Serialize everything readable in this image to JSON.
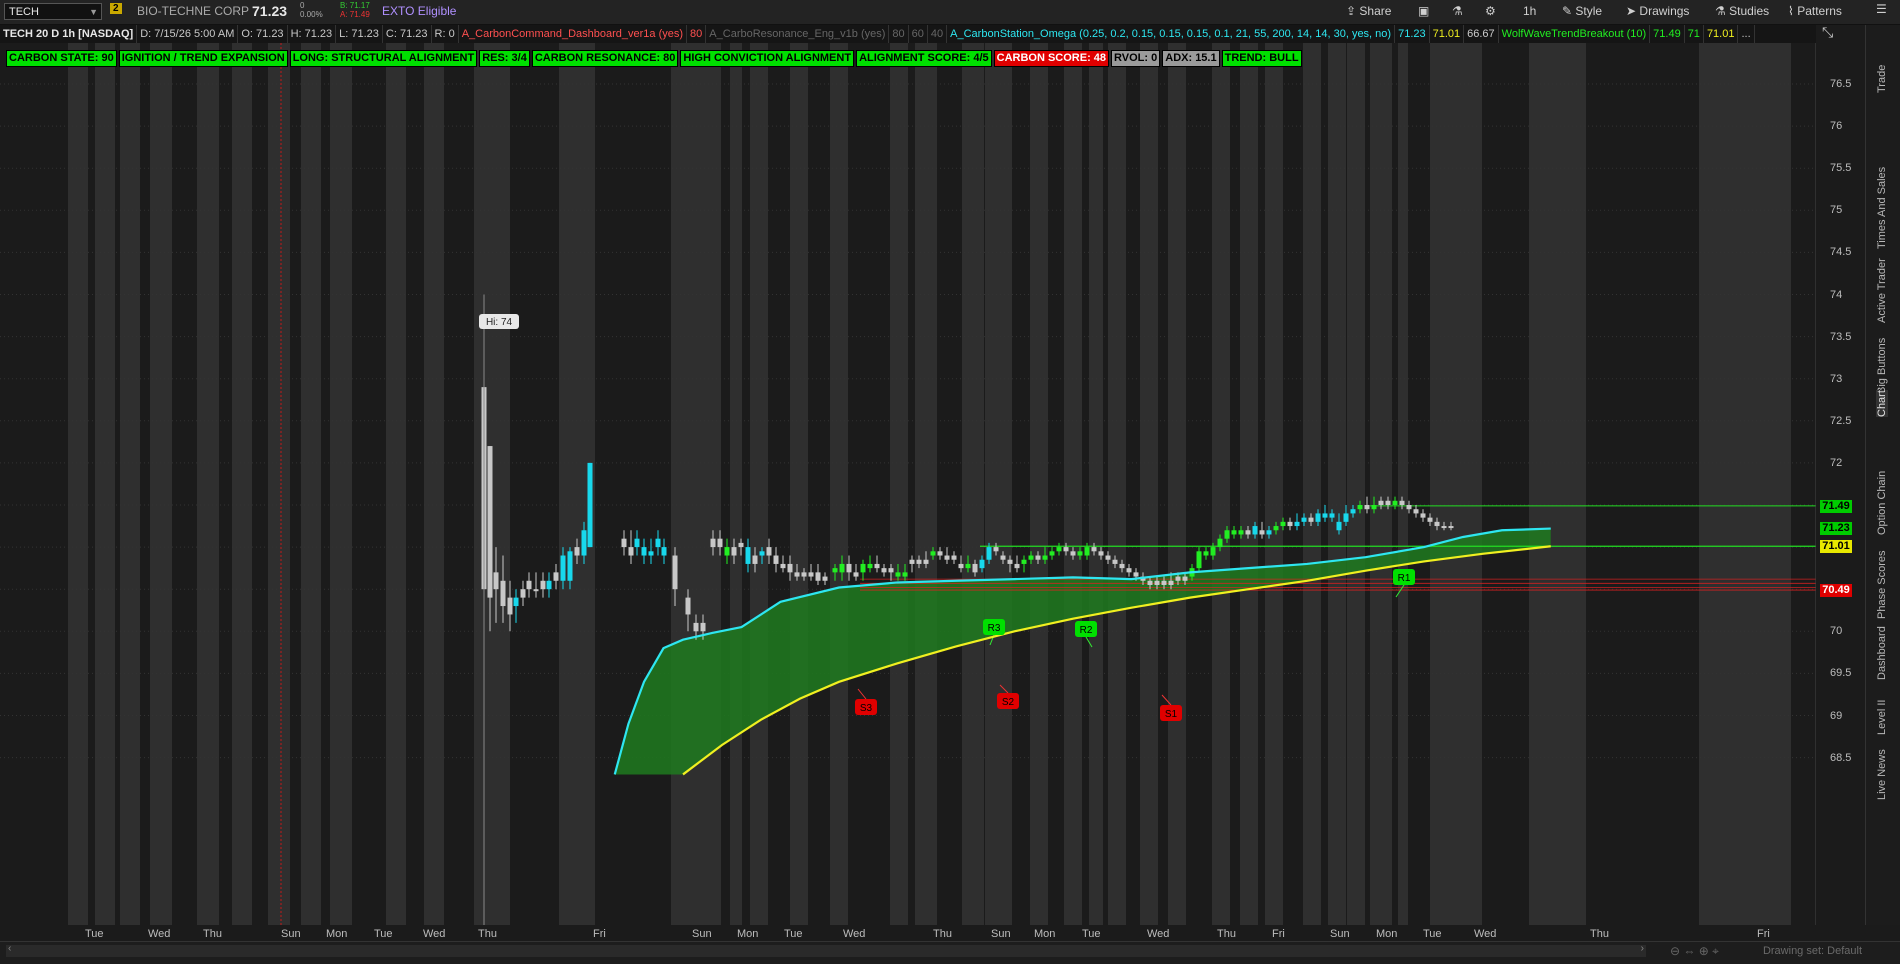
{
  "header": {
    "symbol": "TECH",
    "link_badge": "2",
    "company": "BIO-TECHNE CORP",
    "last": "71.23",
    "change": "0",
    "change_pct": "0.00%",
    "bid": "B: 71.17",
    "ask": "A: 71.49",
    "extended": "EXTO Eligible",
    "share": "Share",
    "timeframe": "1h",
    "style": "Style",
    "drawings": "Drawings",
    "studies": "Studies",
    "patterns": "Patterns"
  },
  "infobar": {
    "chart_title": "TECH 20 D 1h [NASDAQ]",
    "date": "D: 7/15/26 5:00 AM",
    "open": "O: 71.23",
    "high": "H: 71.23",
    "low": "L: 71.23",
    "close": "C: 71.23",
    "range": "R: 0",
    "study1": "A_CarbonCommand_Dashboard_ver1a (yes)",
    "study1_val": "80",
    "study2": "A_CarboResonance_Eng_v1b (yes)",
    "study2_v1": "80",
    "study2_v2": "60",
    "study2_v3": "40",
    "study3": "A_CarbonStation_Omega (0.25, 0.2, 0.15, 0.15, 0.15, 0.1, 21, 55, 200, 14, 14, 30, yes, no)",
    "study3_v1": "71.23",
    "study3_v2": "71.01",
    "study3_v3": "66.67",
    "study4": "WolfWaveTrendBreakout (10)",
    "study4_v1": "71.49",
    "study4_v2": "71",
    "study4_v3": "71.01",
    "more": "..."
  },
  "labels": [
    {
      "text": "CARBON STATE: 90",
      "bg": "#00e000",
      "fg": "#000000"
    },
    {
      "text": "IGNITION / TREND EXPANSION",
      "bg": "#00e000",
      "fg": "#000000"
    },
    {
      "text": "LONG: STRUCTURAL ALIGNMENT",
      "bg": "#00e000",
      "fg": "#000000"
    },
    {
      "text": "RES: 3/4",
      "bg": "#00e000",
      "fg": "#000000"
    },
    {
      "text": "CARBON RESONANCE: 80",
      "bg": "#00e000",
      "fg": "#000000"
    },
    {
      "text": "HIGH CONVICTION ALIGNMENT",
      "bg": "#00e000",
      "fg": "#000000"
    },
    {
      "text": "ALIGNMENT SCORE: 4/5",
      "bg": "#00e000",
      "fg": "#000000"
    },
    {
      "text": "CARBON SCORE: 48",
      "bg": "#e00000",
      "fg": "#ffffff"
    },
    {
      "text": "RVOL: 0",
      "bg": "#9a9a9a",
      "fg": "#000000"
    },
    {
      "text": "ADX: 15.1",
      "bg": "#9a9a9a",
      "fg": "#000000"
    },
    {
      "text": "TREND: BULL",
      "bg": "#00e000",
      "fg": "#000000"
    }
  ],
  "price_axis": [
    "76.5",
    "76",
    "75.5",
    "75",
    "74.5",
    "74",
    "73.5",
    "73",
    "72.5",
    "72",
    "71.5",
    "71",
    "70.5",
    "70",
    "69.5",
    "69",
    "68.5"
  ],
  "price_labels": [
    {
      "text": "71.49",
      "bg": "#00cc00",
      "fg": "#000000",
      "price": 71.49
    },
    {
      "text": "71.23",
      "bg": "#00cc00",
      "fg": "#000000",
      "price": 71.23
    },
    {
      "text": "71.01",
      "bg": "#e8e800",
      "fg": "#000000",
      "price": 71.01
    },
    {
      "text": "70.49",
      "bg": "#e00000",
      "fg": "#ffffff",
      "price": 70.49
    }
  ],
  "time_axis": [
    "Tue",
    "Wed",
    "Thu",
    "Sun",
    "Mon",
    "Tue",
    "Wed",
    "Thu",
    "Fri",
    "Sun",
    "Mon",
    "Tue",
    "Wed",
    "Thu",
    "Sun",
    "Mon",
    "Tue",
    "Wed",
    "Thu",
    "Fri",
    "Sun",
    "Mon",
    "Tue",
    "Wed",
    "Thu",
    "Fri"
  ],
  "annotations": {
    "hi": "Hi: 74",
    "r1": "R1",
    "r2": "R2",
    "r3": "R3",
    "s1": "S1",
    "s2": "S2",
    "s3": "S3"
  },
  "sidebar": [
    "Trade",
    "Times And Sales",
    "Active Trader",
    "Big Buttons",
    "Chart",
    "Option Chain",
    "Phase Scores",
    "Dashboard",
    "Level II",
    "Live News"
  ],
  "footer": {
    "drawing_set": "Drawing set: Default"
  },
  "colors": {
    "fast_ma": "#2ee6f0",
    "slow_ma": "#f0f020",
    "fill": "#1f7a1f",
    "up_candle": "#18d8ec",
    "down_candle": "#c8c8c8",
    "green_candle": "#22ee22",
    "resistance_line": "#22dd22",
    "support_line": "#e02020"
  },
  "chart_data": {
    "type": "candlestick",
    "price_range": [
      68.3,
      76.8
    ],
    "fast_ma": [
      [
        70.0,
        69.98
      ],
      [
        71.0,
        70.35
      ],
      [
        72.0,
        70.55
      ],
      [
        73.0,
        70.6
      ],
      [
        74.0,
        70.62
      ],
      [
        75.0,
        70.7
      ],
      [
        76.0,
        70.9
      ],
      [
        77.0,
        71.05
      ],
      [
        78.0,
        71.2
      ],
      [
        78.5,
        71.22
      ]
    ],
    "slow_ma": [
      [
        67.5,
        68.2
      ],
      [
        70.0,
        69.55
      ],
      [
        72.0,
        69.95
      ],
      [
        73.0,
        70.25
      ],
      [
        74.0,
        70.5
      ],
      [
        75.0,
        70.65
      ],
      [
        76.0,
        70.85
      ],
      [
        77.0,
        70.95
      ],
      [
        78.5,
        71.01
      ]
    ],
    "levels": {
      "r1": 71.49,
      "r2_r3": 71.01,
      "s_lines": [
        70.62,
        70.57,
        70.52,
        70.49
      ]
    }
  }
}
